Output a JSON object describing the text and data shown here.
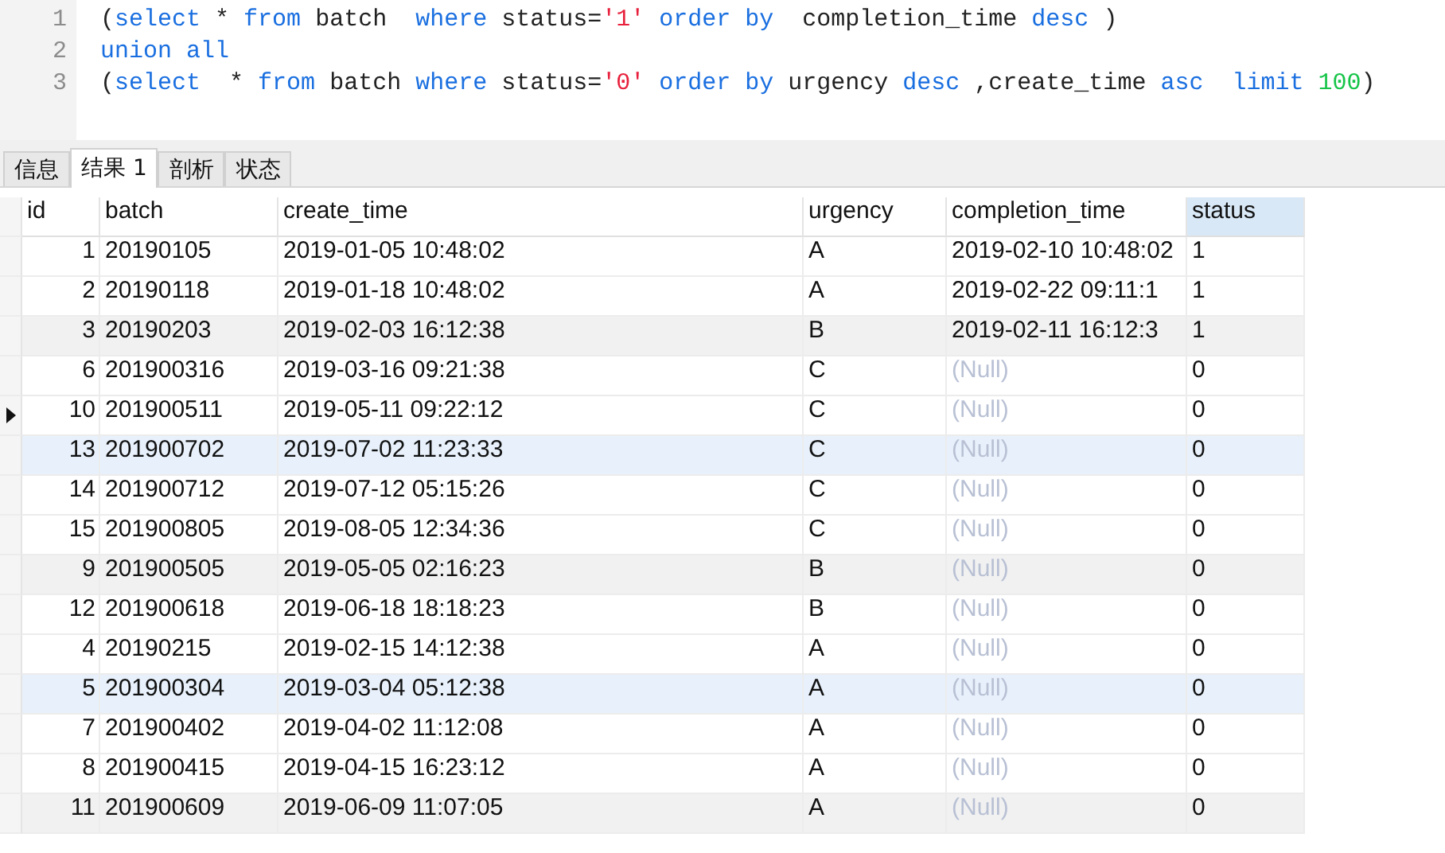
{
  "editor": {
    "lines": [
      {
        "number": "1",
        "tokens": [
          {
            "text": "(",
            "kind": "plain"
          },
          {
            "text": "select",
            "kind": "keyword"
          },
          {
            "text": " * ",
            "kind": "plain"
          },
          {
            "text": "from",
            "kind": "keyword"
          },
          {
            "text": " batch  ",
            "kind": "plain"
          },
          {
            "text": "where",
            "kind": "keyword"
          },
          {
            "text": " status=",
            "kind": "plain"
          },
          {
            "text": "'1'",
            "kind": "string"
          },
          {
            "text": " order by",
            "kind": "keyword"
          },
          {
            "text": "  completion_time ",
            "kind": "plain"
          },
          {
            "text": "desc",
            "kind": "keyword"
          },
          {
            "text": " )",
            "kind": "plain"
          }
        ]
      },
      {
        "number": "2",
        "tokens": [
          {
            "text": "union all",
            "kind": "keyword"
          }
        ]
      },
      {
        "number": "3",
        "tokens": [
          {
            "text": "(",
            "kind": "plain"
          },
          {
            "text": "select",
            "kind": "keyword"
          },
          {
            "text": "  * ",
            "kind": "plain"
          },
          {
            "text": "from",
            "kind": "keyword"
          },
          {
            "text": " batch ",
            "kind": "plain"
          },
          {
            "text": "where",
            "kind": "keyword"
          },
          {
            "text": " status=",
            "kind": "plain"
          },
          {
            "text": "'0'",
            "kind": "string"
          },
          {
            "text": " order by",
            "kind": "keyword"
          },
          {
            "text": " urgency ",
            "kind": "plain"
          },
          {
            "text": "desc",
            "kind": "keyword"
          },
          {
            "text": " ,create_time ",
            "kind": "plain"
          },
          {
            "text": "asc",
            "kind": "keyword"
          },
          {
            "text": "  limit",
            "kind": "keyword"
          },
          {
            "text": " 100",
            "kind": "number"
          },
          {
            "text": ")",
            "kind": "plain"
          }
        ]
      }
    ]
  },
  "tabs": [
    {
      "label": "信息",
      "selected": false
    },
    {
      "label": "结果 1",
      "selected": true
    },
    {
      "label": "剖析",
      "selected": false
    },
    {
      "label": "状态",
      "selected": false
    }
  ],
  "table": {
    "columns": [
      {
        "label": "id",
        "selected": false
      },
      {
        "label": "batch",
        "selected": false
      },
      {
        "label": "create_time",
        "selected": false
      },
      {
        "label": "urgency",
        "selected": false
      },
      {
        "label": "completion_time",
        "selected": false
      },
      {
        "label": "status",
        "selected": true
      }
    ],
    "rows": [
      {
        "id": "1",
        "batch": "20190105",
        "create_time": "2019-01-05 10:48:02",
        "urgency": "A",
        "completion_time": "2019-02-10 10:48:02",
        "is_null": false,
        "status": "1",
        "current": false,
        "striped": false,
        "highlighted": false
      },
      {
        "id": "2",
        "batch": "20190118",
        "create_time": "2019-01-18 10:48:02",
        "urgency": "A",
        "completion_time": "2019-02-22 09:11:1",
        "is_null": false,
        "status": "1",
        "current": false,
        "striped": false,
        "highlighted": false
      },
      {
        "id": "3",
        "batch": "20190203",
        "create_time": "2019-02-03 16:12:38",
        "urgency": "B",
        "completion_time": "2019-02-11 16:12:3",
        "is_null": false,
        "status": "1",
        "current": false,
        "striped": true,
        "highlighted": false
      },
      {
        "id": "6",
        "batch": "201900316",
        "create_time": "2019-03-16 09:21:38",
        "urgency": "C",
        "completion_time": "(Null)",
        "is_null": true,
        "status": "0",
        "current": false,
        "striped": false,
        "highlighted": false
      },
      {
        "id": "10",
        "batch": "201900511",
        "create_time": "2019-05-11 09:22:12",
        "urgency": "C",
        "completion_time": "(Null)",
        "is_null": true,
        "status": "0",
        "current": true,
        "striped": false,
        "highlighted": false
      },
      {
        "id": "13",
        "batch": "201900702",
        "create_time": "2019-07-02 11:23:33",
        "urgency": "C",
        "completion_time": "(Null)",
        "is_null": true,
        "status": "0",
        "current": false,
        "highlighted": true
      },
      {
        "id": "14",
        "batch": "201900712",
        "create_time": "2019-07-12 05:15:26",
        "urgency": "C",
        "completion_time": "(Null)",
        "is_null": true,
        "status": "0",
        "current": false,
        "striped": false,
        "highlighted": false
      },
      {
        "id": "15",
        "batch": "201900805",
        "create_time": "2019-08-05 12:34:36",
        "urgency": "C",
        "completion_time": "(Null)",
        "is_null": true,
        "status": "0",
        "current": false,
        "striped": false,
        "highlighted": false
      },
      {
        "id": "9",
        "batch": "201900505",
        "create_time": "2019-05-05 02:16:23",
        "urgency": "B",
        "completion_time": "(Null)",
        "is_null": true,
        "status": "0",
        "current": false,
        "striped": true,
        "highlighted": false
      },
      {
        "id": "12",
        "batch": "201900618",
        "create_time": "2019-06-18 18:18:23",
        "urgency": "B",
        "completion_time": "(Null)",
        "is_null": true,
        "status": "0",
        "current": false,
        "striped": false,
        "highlighted": false
      },
      {
        "id": "4",
        "batch": "20190215",
        "create_time": "2019-02-15 14:12:38",
        "urgency": "A",
        "completion_time": "(Null)",
        "is_null": true,
        "status": "0",
        "current": false,
        "striped": false,
        "highlighted": false
      },
      {
        "id": "5",
        "batch": "201900304",
        "create_time": "2019-03-04 05:12:38",
        "urgency": "A",
        "completion_time": "(Null)",
        "is_null": true,
        "status": "0",
        "current": false,
        "highlighted": true
      },
      {
        "id": "7",
        "batch": "201900402",
        "create_time": "2019-04-02 11:12:08",
        "urgency": "A",
        "completion_time": "(Null)",
        "is_null": true,
        "status": "0",
        "current": false,
        "striped": false,
        "highlighted": false
      },
      {
        "id": "8",
        "batch": "201900415",
        "create_time": "2019-04-15 16:23:12",
        "urgency": "A",
        "completion_time": "(Null)",
        "is_null": true,
        "status": "0",
        "current": false,
        "striped": false,
        "highlighted": false
      },
      {
        "id": "11",
        "batch": "201900609",
        "create_time": "2019-06-09 11:07:05",
        "urgency": "A",
        "completion_time": "(Null)",
        "is_null": true,
        "status": "0",
        "current": false,
        "striped": true,
        "highlighted": false
      }
    ]
  }
}
